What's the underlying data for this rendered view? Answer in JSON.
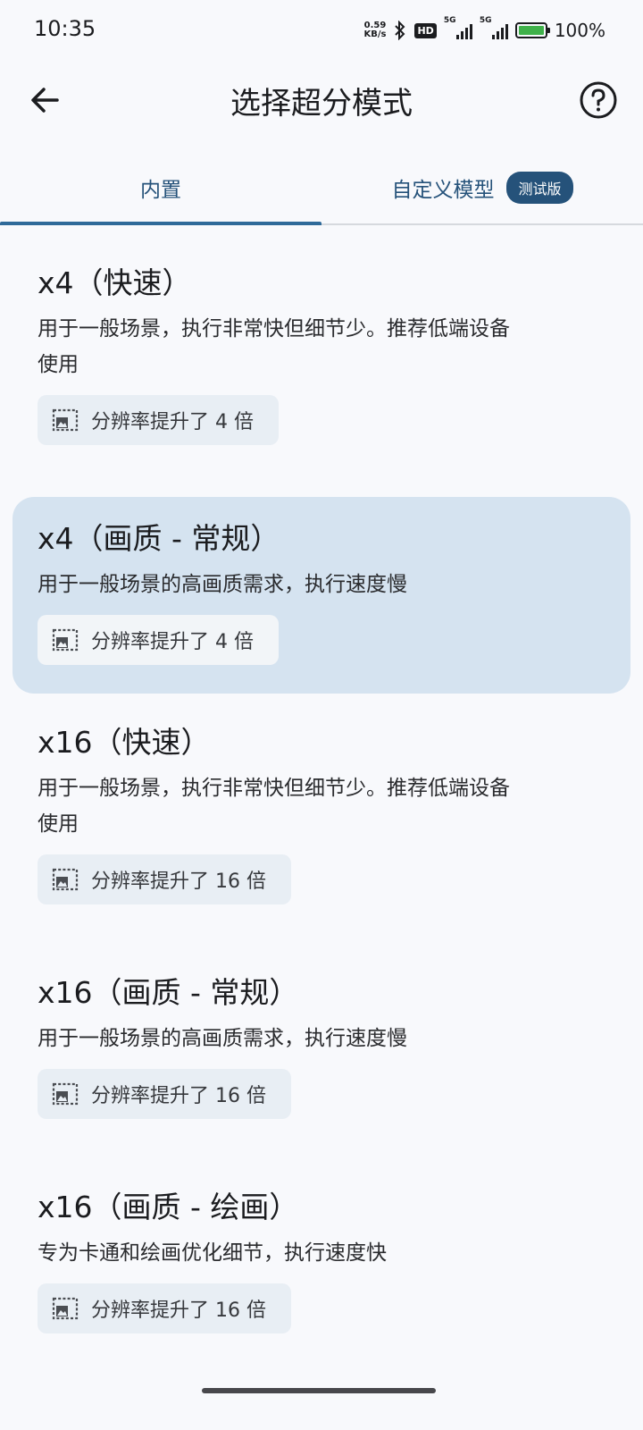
{
  "status_bar": {
    "time": "10:35",
    "net_speed_value": "0.59",
    "net_speed_unit": "KB/s",
    "hd_label": "HD",
    "sig1_label": "5G",
    "sig2_label": "5G",
    "battery_pct": "100%",
    "icons": [
      "bluetooth-icon",
      "hd-icon",
      "signal-icon",
      "signal-icon",
      "battery-charging-icon"
    ]
  },
  "header": {
    "title": "选择超分模式",
    "back_icon": "arrow-left-icon",
    "help_icon": "question-circle-icon"
  },
  "tabs": [
    {
      "label": "内置",
      "active": true
    },
    {
      "label": "自定义模型",
      "badge": "测试版",
      "active": false
    }
  ],
  "modes": [
    {
      "title": "x4（快速）",
      "desc_line1": "用于一般场景，执行非常快但细节少。推荐低端设备",
      "desc_line2": "使用",
      "chip": "分辨率提升了 4 倍",
      "selected": false
    },
    {
      "title": "x4（画质 - 常规）",
      "desc_line1": "用于一般场景的高画质需求，执行速度慢",
      "desc_line2": "",
      "chip": "分辨率提升了 4 倍",
      "selected": true
    },
    {
      "title": "x16（快速）",
      "desc_line1": "用于一般场景，执行非常快但细节少。推荐低端设备",
      "desc_line2": "使用",
      "chip": "分辨率提升了 16 倍",
      "selected": false
    },
    {
      "title": "x16（画质 - 常规）",
      "desc_line1": "用于一般场景的高画质需求，执行速度慢",
      "desc_line2": "",
      "chip": "分辨率提升了 16 倍",
      "selected": false
    },
    {
      "title": "x16（画质 - 绘画）",
      "desc_line1": "专为卡通和绘画优化细节，执行速度快",
      "desc_line2": "",
      "chip": "分辨率提升了 16 倍",
      "selected": false
    }
  ],
  "colors": {
    "accent": "#25527a",
    "selected_bg": "#d5e3f0",
    "chip_bg": "#e8eef4",
    "background": "#f8f9fc"
  }
}
